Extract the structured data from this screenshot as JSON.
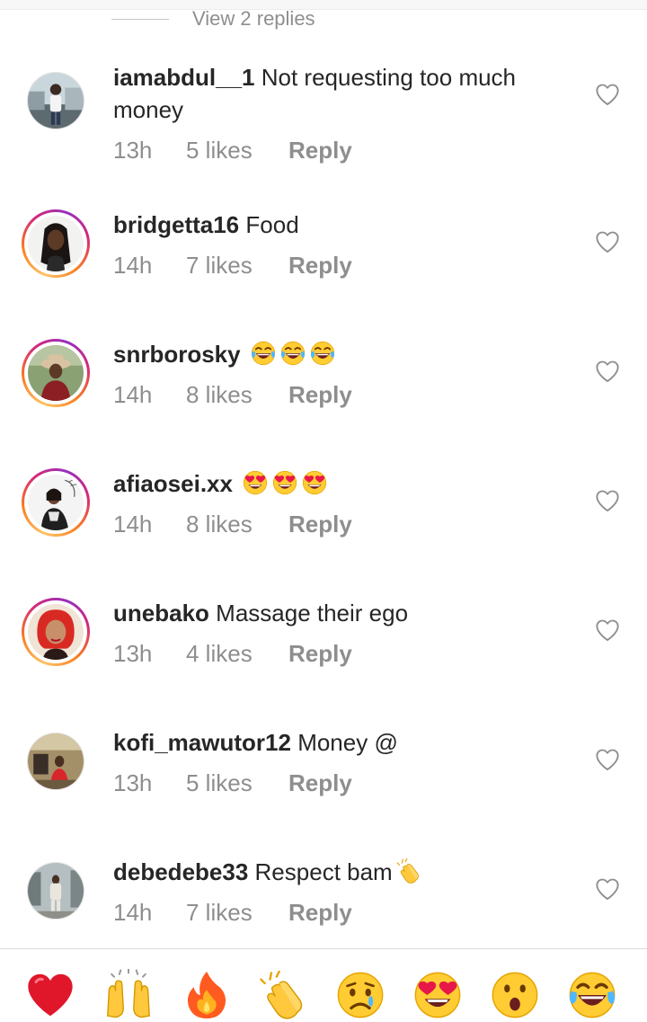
{
  "thread": {
    "view_replies_label": "View 2 replies"
  },
  "comments": [
    {
      "username": "iamabdul__1",
      "text": "Not requesting too much money",
      "time": "13h",
      "likes": "5 likes",
      "reply_label": "Reply",
      "has_story_ring": false
    },
    {
      "username": "bridgetta16",
      "text": "Food",
      "time": "14h",
      "likes": "7 likes",
      "reply_label": "Reply",
      "has_story_ring": true
    },
    {
      "username": "snrborosky",
      "text": "",
      "emojis": [
        "face-with-tears-of-joy",
        "face-with-tears-of-joy",
        "face-with-tears-of-joy"
      ],
      "time": "14h",
      "likes": "8 likes",
      "reply_label": "Reply",
      "has_story_ring": true
    },
    {
      "username": "afiaosei.xx",
      "text": "",
      "emojis": [
        "heart-eyes",
        "heart-eyes",
        "heart-eyes"
      ],
      "time": "14h",
      "likes": "8 likes",
      "reply_label": "Reply",
      "has_story_ring": true
    },
    {
      "username": "unebako",
      "text": "Massage their ego",
      "time": "13h",
      "likes": "4 likes",
      "reply_label": "Reply",
      "has_story_ring": true
    },
    {
      "username": "kofi_mawutor12",
      "text": "Money @",
      "time": "13h",
      "likes": "5 likes",
      "reply_label": "Reply",
      "has_story_ring": false
    },
    {
      "username": "debedebe33",
      "text": "Respect bam",
      "emojis": [
        "clapping-hands"
      ],
      "time": "14h",
      "likes": "7 likes",
      "reply_label": "Reply",
      "has_story_ring": false
    }
  ],
  "reaction_bar": {
    "reactions": [
      "red-heart",
      "raising-hands",
      "fire",
      "clapping-hands",
      "sad-face",
      "heart-eyes",
      "surprised-face",
      "face-with-tears-of-joy"
    ]
  },
  "colors": {
    "text": "#262626",
    "secondary": "#8e8e8e",
    "story_ring": [
      "#fdc468",
      "#fa7e1e",
      "#d62976",
      "#962fbf"
    ]
  }
}
